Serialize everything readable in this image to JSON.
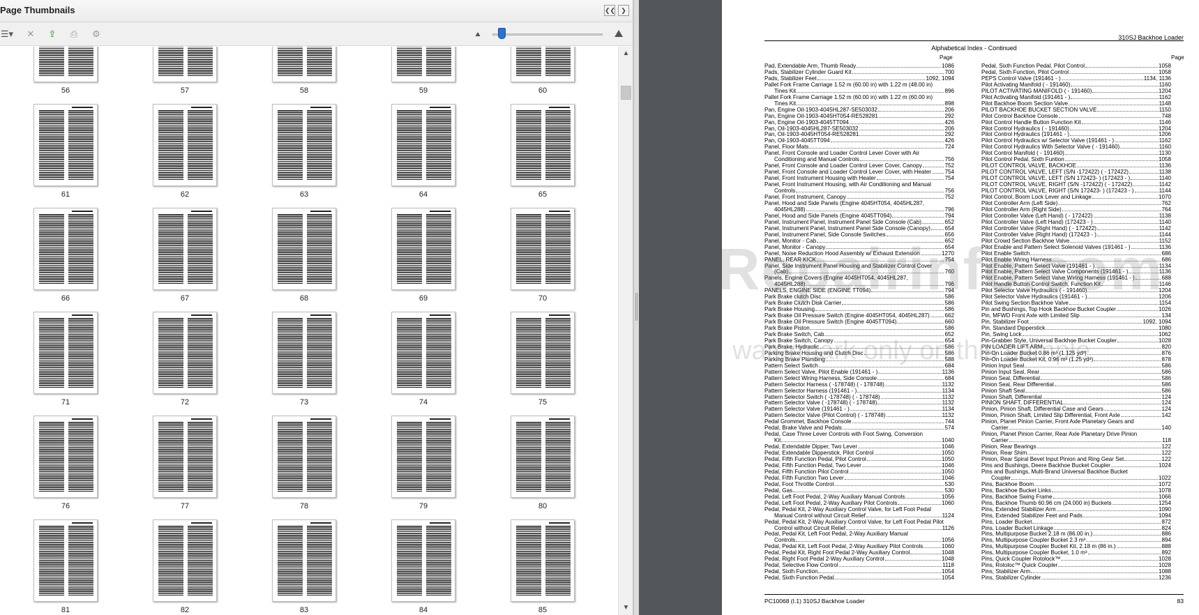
{
  "panel": {
    "title": "Page Thumbnails",
    "prev_panel_button": "❮❮",
    "next_panel_button": "❯",
    "toolbar": {
      "options_icon": "☰▾",
      "delete_icon": "✕",
      "extract_icon": "⇪",
      "print_icon": "⎙",
      "properties_icon": "⚙",
      "zoom_out_icon": "⛰",
      "zoom_in_icon": "⛰"
    },
    "scrollbar": {
      "up": "▲",
      "down": "▼"
    }
  },
  "thumbnails": {
    "rows": [
      [
        "56",
        "57",
        "58",
        "59",
        "60"
      ],
      [
        "61",
        "62",
        "63",
        "64",
        "65"
      ],
      [
        "66",
        "67",
        "68",
        "69",
        "70"
      ],
      [
        "71",
        "72",
        "73",
        "74",
        "75"
      ],
      [
        "76",
        "77",
        "78",
        "79",
        "80"
      ],
      [
        "81",
        "82",
        "83",
        "84",
        "85"
      ]
    ]
  },
  "document": {
    "header": "310SJ Backhoe Loader",
    "subtitle": "Alphabetical Index - Continued",
    "page_col_label": "Page",
    "left_entries": [
      {
        "t": "Pad, Extendable Arm, Thumb Ready",
        "p": "1086"
      },
      {
        "t": "Pads, Stabilizer Cylinder Guard Kit",
        "p": "700"
      },
      {
        "t": "Pads, Stabilizer Feet",
        "p": "1092, 1094"
      },
      {
        "t": "Pallet Fork Frame Carriage 1.52 m (60.00 in) with 1.22 m (48.00 in)",
        "p": ""
      },
      {
        "t": "Tines Kit",
        "p": "896",
        "c": true
      },
      {
        "t": "Pallet Fork Frame Carriage 1.52 m (60.00 in) with 1.22 m (60.00 in)",
        "p": ""
      },
      {
        "t": "Tines Kit",
        "p": "898",
        "c": true
      },
      {
        "t": "Pan, Engine Oil-1903-4045HL287-SE503032",
        "p": "206"
      },
      {
        "t": "Pan, Engine Oil-1903-4045HT054-RE528281",
        "p": "292"
      },
      {
        "t": "Pan, Engine Oil-1903-4045TT094",
        "p": "426"
      },
      {
        "t": "Pan, Oil-1903-4045HL287-SE503032",
        "p": "206"
      },
      {
        "t": "Pan, Oil-1903-4045HT054-RE528281",
        "p": "292"
      },
      {
        "t": "Pan, Oil-1903-4045TT094",
        "p": "426"
      },
      {
        "t": "Panel, Floor Mats",
        "p": "724"
      },
      {
        "t": "Panel, Front Console and Loader Control Lever Cover with Air",
        "p": ""
      },
      {
        "t": "Conditioning and Manual Controls",
        "p": "756",
        "c": true
      },
      {
        "t": "Panel, Front Console and Loader Control Lever Cover, Canopy",
        "p": "752"
      },
      {
        "t": "Panel, Front Console and Loader Control Lever Cover, with Heater",
        "p": "754"
      },
      {
        "t": "Panel, Front Instrument Housing with Heater",
        "p": "754"
      },
      {
        "t": "Panel, Front Instrument Housing, with Air Conditioning and Manual",
        "p": ""
      },
      {
        "t": "Controls",
        "p": "756",
        "c": true
      },
      {
        "t": "Panel, Front Instrument, Canopy",
        "p": "752"
      },
      {
        "t": "Panel, Hood and Side Panels (Engine 4045HT054, 4045HL287,",
        "p": ""
      },
      {
        "t": "4045HL288)",
        "p": "796",
        "c": true
      },
      {
        "t": "Panel, Hood and Side Panels (Engine 4045TT094)",
        "p": "794"
      },
      {
        "t": "Panel, Instrument Panel, Instrument Panel Side Console (Cab)",
        "p": "652"
      },
      {
        "t": "Panel, Instrument Panel, Instrument Panel Side Console (Canopy)",
        "p": "654"
      },
      {
        "t": "Panel, Instrument Panel, Side Console Switches",
        "p": "656"
      },
      {
        "t": "Panel, Monitor - Cab",
        "p": "652"
      },
      {
        "t": "Panel, Monitor - Canopy",
        "p": "654"
      },
      {
        "t": "Panel, Noise Reduction Hood Assembly w/ Exhaust Extension",
        "p": "1270"
      },
      {
        "t": "PANEL, REAR KICK",
        "p": "754"
      },
      {
        "t": "Panel, Side Instrument Panel Housing and Stabilizer Control Cover",
        "p": ""
      },
      {
        "t": "(Cab)",
        "p": "760",
        "c": true
      },
      {
        "t": "Panels, Engine Covers (Engine 4045HT054, 4045HL287,",
        "p": ""
      },
      {
        "t": "4045HL288)",
        "p": "796",
        "c": true
      },
      {
        "t": "PANELS, ENGINE SIDE (ENGINE TT094)",
        "p": "794"
      },
      {
        "t": "Park Brake clutch Disc",
        "p": "586"
      },
      {
        "t": "Park Brake Clutch Disk Carrier",
        "p": "586"
      },
      {
        "t": "Park Brake Housing",
        "p": "586"
      },
      {
        "t": "Park Brake Oil Pressure Switch (Engine 4045HT054, 4045HL287)",
        "p": "662"
      },
      {
        "t": "Park Brake Oil Pressure Switch (Engine 4045TT094)",
        "p": "660"
      },
      {
        "t": "Park Brake Piston",
        "p": "586"
      },
      {
        "t": "Park Brake Switch, Cab",
        "p": "652"
      },
      {
        "t": "Park Brake Switch, Canopy",
        "p": "654"
      },
      {
        "t": "Park Brake, Hydraulic",
        "p": "586"
      },
      {
        "t": "Parking Brake Housing and Clutch Disc",
        "p": "586"
      },
      {
        "t": "Parking Brake Plumbing",
        "p": "588"
      },
      {
        "t": "Pattern Select Switch",
        "p": "684"
      },
      {
        "t": "Pattern Select Valve, Pilot Enable (191461 - )",
        "p": "1136"
      },
      {
        "t": "Pattern Select Wiring Harness, Side Console",
        "p": "684"
      },
      {
        "t": "Pattern Selector Harness ( -178748) ( - 178748)",
        "p": "1132"
      },
      {
        "t": "Pattern Selector Harness (191461 - )",
        "p": "1134"
      },
      {
        "t": "Pattern Selector Switch ( -178748) ( - 178748)",
        "p": "1132"
      },
      {
        "t": "Pattern Selector Valve ( -178748) ( - 178748)",
        "p": "1132"
      },
      {
        "t": "Pattern Selector Valve (191461 - )",
        "p": "1134"
      },
      {
        "t": "Pattern Selector Valve (Pilot Control) ( - 178748)",
        "p": "1132"
      },
      {
        "t": "Pedal Grommet, Backhoe Console",
        "p": "744"
      },
      {
        "t": "Pedal, Brake Valve and Pedals",
        "p": "574"
      },
      {
        "t": "Pedal, Case Three Lever Controls with Foot Swing, Conversion",
        "p": ""
      },
      {
        "t": "Kit",
        "p": "1040",
        "c": true
      },
      {
        "t": "Pedal, Extendable Dipper, Two Lever",
        "p": "1046"
      },
      {
        "t": "Pedal, Extendable Dipperstick, Pilot Control",
        "p": "1050"
      },
      {
        "t": "Pedal, Fifth Function Pedal, Pilot Control",
        "p": "1050"
      },
      {
        "t": "Pedal, Fifth Function Pedal, Two Lever",
        "p": "1046"
      },
      {
        "t": "Pedal, Fifth Function Pilot Control",
        "p": "1050"
      },
      {
        "t": "Pedal, Fifth Function Two Lever",
        "p": "1046"
      },
      {
        "t": "Pedal, Foot Throttle Control",
        "p": "530"
      },
      {
        "t": "Pedal, Gas",
        "p": "530"
      },
      {
        "t": "Pedal, Left Foot Pedal, 2-Way Auxiliary Manual Controls",
        "p": "1056"
      },
      {
        "t": "Pedal, Left Foot Pedal, 2-Way Auxiliary Pilot Controls",
        "p": "1060"
      },
      {
        "t": "Pedal, Pedal Kit, 2-Way Auxiliary Control Valve, for Left Foot Pedal",
        "p": ""
      },
      {
        "t": "Manual Control without Circuit Relief",
        "p": "1124",
        "c": true
      },
      {
        "t": "Pedal, Pedal Kit, 2-Way Auxiliary Control Valve, for Left Foot Pedal Pilot",
        "p": ""
      },
      {
        "t": "Control without Circuit Relief",
        "p": "1126",
        "c": true
      },
      {
        "t": "Pedal, Pedal Kit, Left Foot Pedal, 2-Way Auxiliary Manual",
        "p": ""
      },
      {
        "t": "Controls",
        "p": "1056",
        "c": true
      },
      {
        "t": "Pedal, Pedal Kit, Left Foot Pedal, 2-Way Auxiliary Pilot Controls",
        "p": "1060"
      },
      {
        "t": "Pedal, Pedal Kit, Right Foot Pedal 2-Way Auxiliary Control",
        "p": "1048"
      },
      {
        "t": "Pedal, Right Foot Pedal 2-Way Auxiliary Control",
        "p": "1048"
      },
      {
        "t": "Pedal, Selective Flow Control",
        "p": "1118"
      },
      {
        "t": "Pedal, Sixth Function",
        "p": "1054"
      },
      {
        "t": "Pedal, Sixth Function Pedal",
        "p": "1054"
      }
    ],
    "right_entries": [
      {
        "t": "Pedal, Sixth Function Pedal, Pilot Control",
        "p": "1058"
      },
      {
        "t": "Pedal, Sixth Function, Pilot Control",
        "p": "1058"
      },
      {
        "t": "PEPS Control Valve (191461 - )",
        "p": "1134, 1136"
      },
      {
        "t": "Pilot Activating Manifold ( - 191460)",
        "p": "1160"
      },
      {
        "t": "PILOT ACTIVATING MANIFOLD ( - 191460)",
        "p": "1204"
      },
      {
        "t": "Pilot Activating Manifold (191461 - )",
        "p": "1162"
      },
      {
        "t": "Pilot Backhoe Boom Section Valve",
        "p": "1148"
      },
      {
        "t": "PILOT BACKHOE BUCKET SECTION VALVE",
        "p": "1150"
      },
      {
        "t": "Pilot Control Backhoe Console",
        "p": "748"
      },
      {
        "t": "Pilot Control Handle Button Function Kit",
        "p": "1146"
      },
      {
        "t": "Pilot Control Hydraulics ( - 191460)",
        "p": "1204"
      },
      {
        "t": "Pilot Control Hydraulics (191461 - )",
        "p": "1206"
      },
      {
        "t": "Pilot Control Hydraulics w/ Selector Valve (191461 - )",
        "p": "1162"
      },
      {
        "t": "Pilot Control Hydraulics With Selector Valve ( - 191460)",
        "p": "1160"
      },
      {
        "t": "Pilot Control Manifold ( - 191460)",
        "p": "1130"
      },
      {
        "t": "Pilot Control Pedal, Sixth Funtion",
        "p": "1058"
      },
      {
        "t": "PILOT CONTROL VALVE, BACKHOE",
        "p": "1136"
      },
      {
        "t": "PILOT CONTROL VALVE, LEFT (S/N -172422) ( - 172422)",
        "p": "1138"
      },
      {
        "t": "PILOT CONTROL VALVE, LEFT (S/N 172423- ) (172423 - )",
        "p": "1140"
      },
      {
        "t": "PILOT CONTROL VALVE, RIGHT (S/N -172422) ( - 172422)",
        "p": "1142"
      },
      {
        "t": "PILOT CONTROL VALVE, RIGHT (S/N 172423- ) (172423 - )",
        "p": "1144"
      },
      {
        "t": "Pilot Control, Boom Lock Lever and Linkage",
        "p": "1070"
      },
      {
        "t": "Pilot Controller Arm (Left Side)",
        "p": "762"
      },
      {
        "t": "Pilot Controller Arm (Right Side)",
        "p": "764"
      },
      {
        "t": "Pilot Controller Valve (Left Hand) ( - 172422)",
        "p": "1138"
      },
      {
        "t": "Pilot Controller Valve (Left Hand) (172423 - )",
        "p": "1140"
      },
      {
        "t": "Pilot Controller Valve (Right Hand) ( - 172422)",
        "p": "1142"
      },
      {
        "t": "Pilot Controller Valve (Right Hand) (172423 - )",
        "p": "1144"
      },
      {
        "t": "Pilot Crowd Section Backhoe Valve",
        "p": "1152"
      },
      {
        "t": "Pilot Enable and Pattern Select Solenoid Valves (191461 - )",
        "p": "1136"
      },
      {
        "t": "Pilot Enable Switch",
        "p": "686"
      },
      {
        "t": "Pilot Enable Wiring Harness",
        "p": "686"
      },
      {
        "t": "Pilot Enable, Pattern Select Valve (191461 - )",
        "p": "1134"
      },
      {
        "t": "Pilot Enable, Pattern Select Valve Components (191461 - )",
        "p": "1136"
      },
      {
        "t": "Pilot Enable, Pattern Select Valve Wiring Harness (191461 - )",
        "p": "688"
      },
      {
        "t": "Pilot Handle Button Control Switch, Function Kit",
        "p": "1146"
      },
      {
        "t": "Pilot Selector Valve Hydraulics ( - 191460)",
        "p": "1204"
      },
      {
        "t": "Pilot Selector Valve Hydraulics (191461 - )",
        "p": "1206"
      },
      {
        "t": "Pilot Swing Section Backhoe Valve",
        "p": "1154"
      },
      {
        "t": "Pin and Bushings, Top Hook Backhoe Bucket Coupler",
        "p": "1026"
      },
      {
        "t": "Pin, MFWD Front Axle with Limited Slip",
        "p": "134"
      },
      {
        "t": "Pin, Stabilizer Foot",
        "p": "1092, 1094"
      },
      {
        "t": "Pin, Standard Dipperstick",
        "p": "1080"
      },
      {
        "t": "Pin, Swing Lock",
        "p": "1062"
      },
      {
        "t": "Pin-Grabber Style, Universal Backhoe Bucket Coupler",
        "p": "1028"
      },
      {
        "t": "PIN LOADER LIFT ARM",
        "p": "820"
      },
      {
        "t": "Pin-On Loader Bucket 0.86 m³ (1.125 yd³)",
        "p": "876"
      },
      {
        "t": "Pin-On Loader Bucket Kit, 0.96 m³ (1.25 yd³)",
        "p": "878"
      },
      {
        "t": "Pinion Input Seal",
        "p": "586"
      },
      {
        "t": "Pinion Input Seal, Rear",
        "p": "586"
      },
      {
        "t": "Pinion Seal, Differential",
        "p": "586"
      },
      {
        "t": "Pinion Seal, Rear Differential",
        "p": "586"
      },
      {
        "t": "Pinion Shaft Seal",
        "p": "586"
      },
      {
        "t": "Pinion Shaft, Differential",
        "p": "124"
      },
      {
        "t": "PINION SHAFT, DIFFERENTIAL",
        "p": "124"
      },
      {
        "t": "Pinion, Pinion Shaft, Differential Case and Gears",
        "p": "124"
      },
      {
        "t": "Pinion, Pinion Shaft, Limited Slip Differential, Front Axle",
        "p": "142"
      },
      {
        "t": "Pinion, Planet Pinion Carrier, Front Axle Planetary Gears and",
        "p": ""
      },
      {
        "t": "Carrier",
        "p": "140",
        "c": true
      },
      {
        "t": "Pinion, Planet Pinion Carrier, Rear Axle Planetary Drive Pinion",
        "p": ""
      },
      {
        "t": "Carrier",
        "p": "118",
        "c": true
      },
      {
        "t": "Pinion, Rear Bearings",
        "p": "122"
      },
      {
        "t": "Pinion, Rear Shim",
        "p": "122"
      },
      {
        "t": "Pinion, Rear Spiral Bevel Input Pinion and Ring Gear Set",
        "p": "122"
      },
      {
        "t": "Pins and Bushings, Deere Backhoe Bucket Coupler",
        "p": "1024"
      },
      {
        "t": "Pins and Bushings, Multi-Brand Universal Backhoe Bucket",
        "p": ""
      },
      {
        "t": "Coupler",
        "p": "1022",
        "c": true
      },
      {
        "t": "Pins, Backhoe Boom",
        "p": "1072"
      },
      {
        "t": "Pins, Backhoe Bucket Links",
        "p": "1078"
      },
      {
        "t": "Pins, Backhoe Swing Frame",
        "p": "1066"
      },
      {
        "t": "Pins, Backhoe Thumb 60.96 cm (24.000 in) Buckets",
        "p": "1254"
      },
      {
        "t": "Pins, Extended Stabilizer Arm",
        "p": "1090"
      },
      {
        "t": "Pins, Extended Stabilizer Feet and Pads",
        "p": "1094"
      },
      {
        "t": "Pins, Loader Bucket",
        "p": "872"
      },
      {
        "t": "Pins, Loader Bucket Linkage",
        "p": "824"
      },
      {
        "t": "Pins, Multipurpose Bucket 2.18 m (86.00 in.)",
        "p": "886"
      },
      {
        "t": "Pins, Multipurpose Coupler Bucket 2.3 m³",
        "p": "894"
      },
      {
        "t": "Pins, Multipurpose Coupler Bucket Kit, 2.18 m (86 in.)",
        "p": "888"
      },
      {
        "t": "Pins, Multipurpose Coupler Bucket, 1.0 m³",
        "p": "892"
      },
      {
        "t": "Pins, Quick Coupler Rotolock™",
        "p": "1028"
      },
      {
        "t": "Pins, Rotoloc™ Quick Coupler",
        "p": "1028"
      },
      {
        "t": "Pins, Stabilizer Arm",
        "p": "1088"
      },
      {
        "t": "Pins, Stabilizer Cylinder",
        "p": "1236"
      }
    ],
    "footer_left": "PC10068   (I.1)     310SJ Backhoe Loader",
    "footer_right": "83",
    "watermark_main": "eRepairinfo.com",
    "watermark_sub": "watermark only on this sample"
  }
}
